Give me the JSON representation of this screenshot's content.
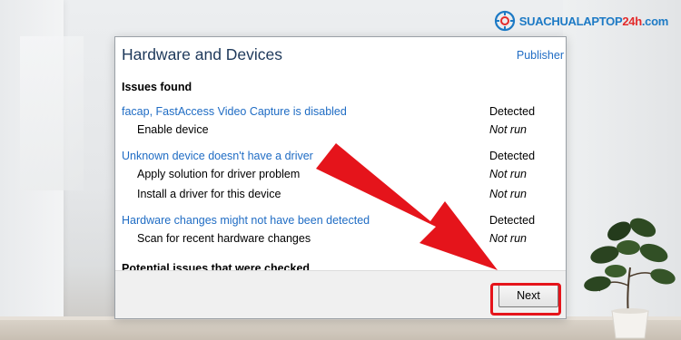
{
  "brand": {
    "name_main": "SUACHUALAPTOP",
    "name_accent": "24h",
    "name_suffix": ".com"
  },
  "dialog": {
    "title": "Hardware and Devices",
    "publisher_link": "Publisher",
    "issues_heading": "Issues found",
    "issues": [
      {
        "label": "facap, FastAccess Video Capture is disabled",
        "status": "Detected",
        "subitems": [
          {
            "label": "Enable device",
            "status": "Not run"
          }
        ]
      },
      {
        "label": "Unknown device doesn't have a driver",
        "status": "Detected",
        "subitems": [
          {
            "label": "Apply solution for driver problem",
            "status": "Not run"
          },
          {
            "label": "Install a driver for this device",
            "status": "Not run"
          }
        ]
      },
      {
        "label": "Hardware changes might not have been detected",
        "status": "Detected",
        "subitems": [
          {
            "label": "Scan for recent hardware changes",
            "status": "Not run"
          }
        ]
      }
    ],
    "checked_heading": "Potential issues that were checked",
    "next_button": "Next"
  },
  "colors": {
    "link": "#1f6cc4",
    "title": "#1e395b",
    "annotation_red": "#e5141b",
    "brand_blue": "#1d7ac5",
    "brand_red": "#e32b2b"
  }
}
